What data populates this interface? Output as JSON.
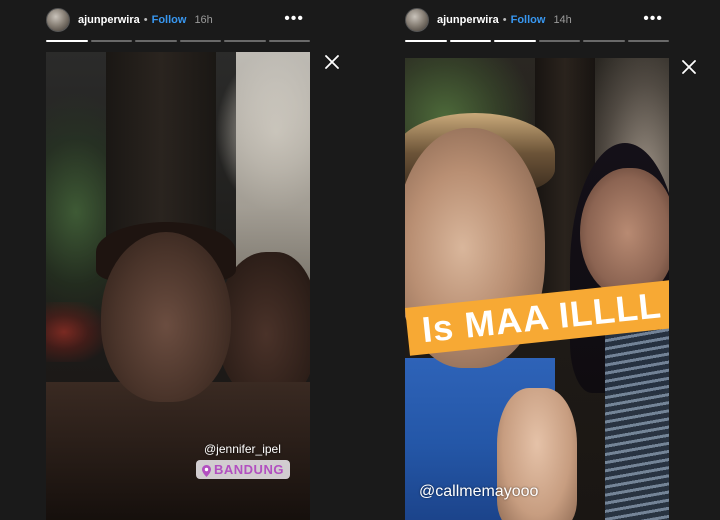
{
  "stories": [
    {
      "username": "ajunperwira",
      "separator": "•",
      "follow_label": "Follow",
      "time": "16h",
      "more_label": "•••",
      "progress_total": 6,
      "progress_done": 1,
      "mention": "@jennifer_ipel",
      "location": "BANDUNG"
    },
    {
      "username": "ajunperwira",
      "separator": "•",
      "follow_label": "Follow",
      "time": "14h",
      "more_label": "•••",
      "progress_total": 6,
      "progress_done": 3,
      "caption": "Is MAA ILLLL",
      "mention": "@callmemayooo"
    }
  ],
  "colors": {
    "background": "#1a1a1a",
    "follow": "#3897f0",
    "caption_banner": "#f7a934",
    "location_text": "#b24fc0"
  },
  "icons": {
    "close": "close-icon",
    "more": "more-options-icon",
    "location": "location-pin-icon"
  }
}
